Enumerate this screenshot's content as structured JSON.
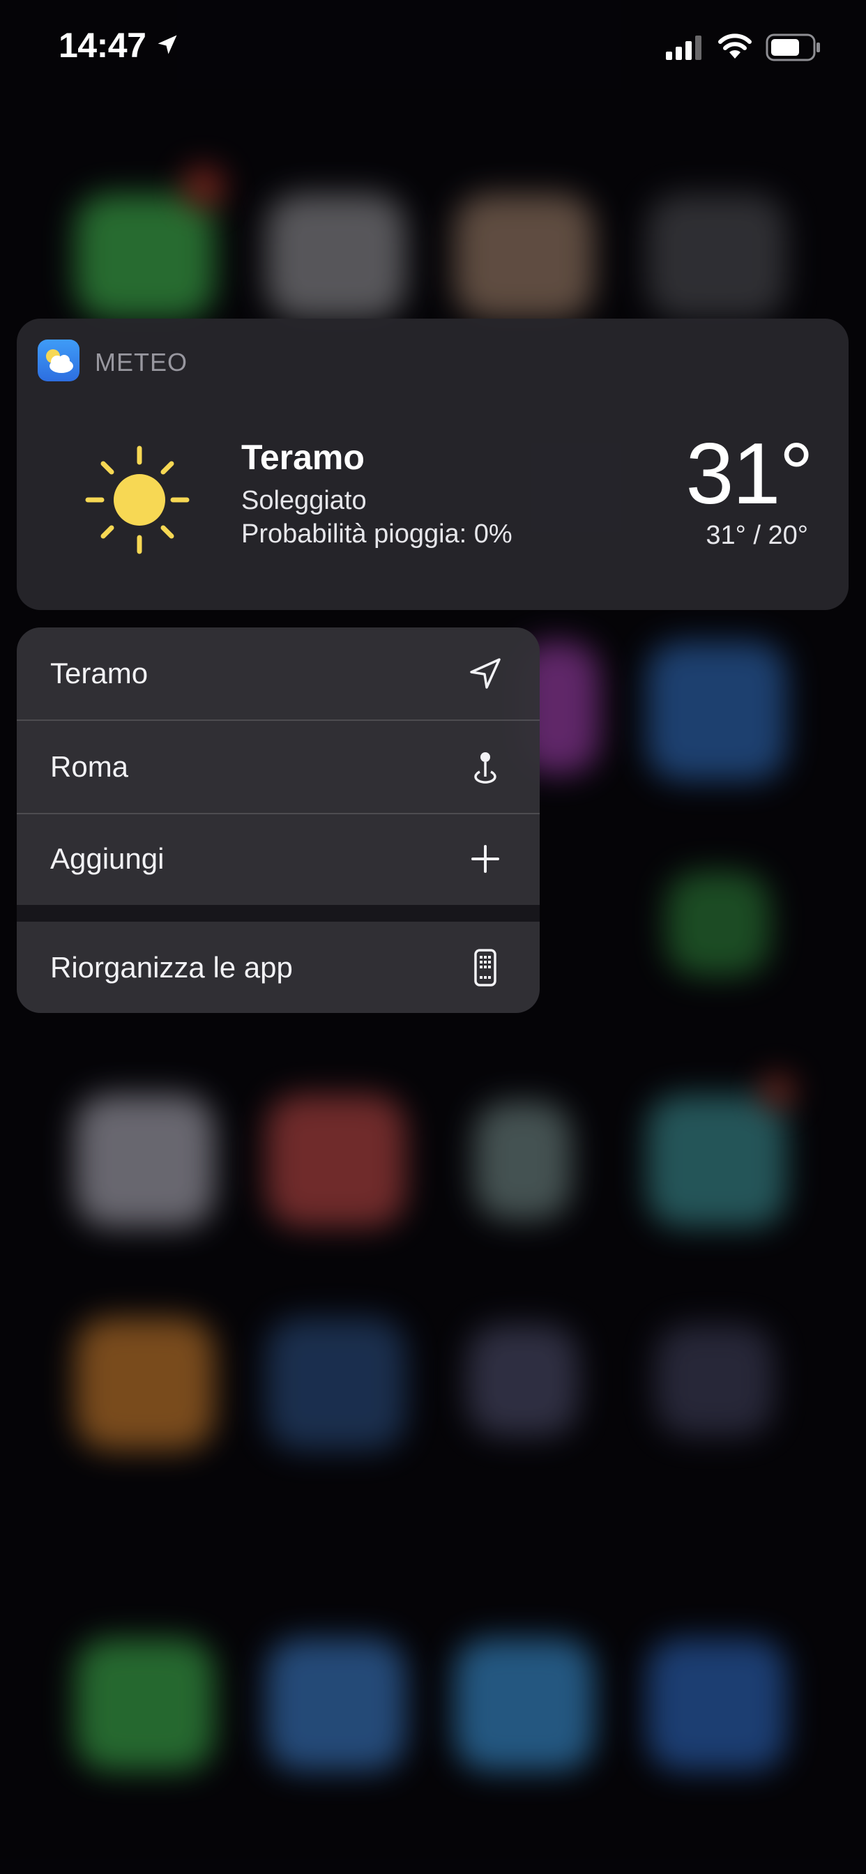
{
  "status_bar": {
    "time": "14:47"
  },
  "widget": {
    "app_name": "METEO",
    "city": "Teramo",
    "condition": "Soleggiato",
    "rain_chance": "Probabilità pioggia: 0%",
    "temperature": "31°",
    "range": "31° / 20°",
    "sun_color": "#f7d854"
  },
  "menu": {
    "items": [
      {
        "label": "Teramo",
        "icon": "location-arrow-icon"
      },
      {
        "label": "Roma",
        "icon": "map-pin-icon"
      },
      {
        "label": "Aggiungi",
        "icon": "plus-icon"
      },
      {
        "label": "Riorganizza le app",
        "icon": "phone-grid-icon"
      }
    ]
  }
}
